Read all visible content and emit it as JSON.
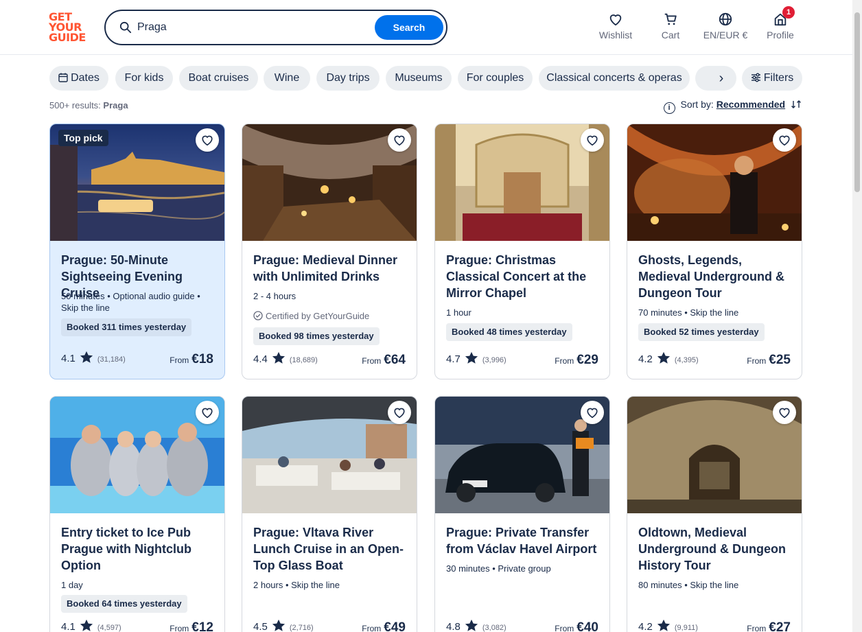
{
  "brand": {
    "logo_lines": [
      "GET",
      "YOUR",
      "GUIDE"
    ],
    "accent": "#ff5533",
    "primary": "#0071eb",
    "text": "#1a2b49"
  },
  "search": {
    "value": "Praga",
    "button": "Search"
  },
  "nav": {
    "wishlist": "Wishlist",
    "cart": "Cart",
    "language": "EN/EUR €",
    "profile": "Profile",
    "profile_badge": "1"
  },
  "chips": [
    "Dates",
    "For kids",
    "Boat cruises",
    "Wine",
    "Day trips",
    "Museums",
    "For couples",
    "Classical concerts & operas"
  ],
  "filters_label": "Filters",
  "results": {
    "count": "500+ results:",
    "query": "Praga"
  },
  "sort": {
    "label": "Sort by:",
    "value": "Recommended"
  },
  "cards": [
    {
      "title": "Prague: 50-Minute Sightseeing Evening Cruise",
      "meta": "50 minutes • Optional audio guide • Skip the line",
      "tag": "Top pick",
      "certified": "",
      "booked": "Booked 311 times yesterday",
      "rating": "4.1",
      "reviews": "(31,184)",
      "from": "From",
      "price": "€18",
      "image": "night-river-cruise"
    },
    {
      "title": "Prague: Medieval Dinner with Unlimited Drinks",
      "meta": "2 - 4 hours",
      "tag": "",
      "certified": "Certified by GetYourGuide",
      "booked": "Booked 98 times yesterday",
      "rating": "4.4",
      "reviews": "(18,689)",
      "from": "From",
      "price": "€64",
      "image": "medieval-tavern"
    },
    {
      "title": "Prague: Christmas Classical Concert at the Mirror Chapel",
      "meta": "1 hour",
      "tag": "",
      "certified": "",
      "booked": "Booked 48 times yesterday",
      "rating": "4.7",
      "reviews": "(3,996)",
      "from": "From",
      "price": "€29",
      "image": "baroque-chapel"
    },
    {
      "title": "Ghosts, Legends, Medieval Underground & Dungeon Tour",
      "meta": "70 minutes • Skip the line",
      "tag": "",
      "certified": "",
      "booked": "Booked 52 times yesterday",
      "rating": "4.2",
      "reviews": "(4,395)",
      "from": "From",
      "price": "€25",
      "image": "underground-cellar"
    },
    {
      "title": "Entry ticket to Ice Pub Prague with Nightclub Option",
      "meta": "1 day",
      "tag": "",
      "certified": "",
      "booked": "Booked 64 times yesterday",
      "rating": "4.1",
      "reviews": "(4,597)",
      "from": "From",
      "price": "€12",
      "image": "ice-pub"
    },
    {
      "title": "Prague: Vltava River Lunch Cruise in an Open-Top Glass Boat",
      "meta": "2 hours • Skip the line",
      "tag": "",
      "certified": "",
      "booked": "",
      "rating": "4.5",
      "reviews": "(2,716)",
      "from": "From",
      "price": "€49",
      "image": "glass-boat"
    },
    {
      "title": "Prague: Private Transfer from Václav Havel Airport",
      "meta": "30 minutes • Private group",
      "tag": "",
      "certified": "",
      "booked": "",
      "rating": "4.8",
      "reviews": "(3,082)",
      "from": "From",
      "price": "€40",
      "image": "airport-car"
    },
    {
      "title": "Oldtown, Medieval Underground & Dungeon History Tour",
      "meta": "80 minutes • Skip the line",
      "tag": "",
      "certified": "",
      "booked": "",
      "rating": "4.2",
      "reviews": "(9,911)",
      "from": "From",
      "price": "€27",
      "image": "stone-vault"
    }
  ]
}
